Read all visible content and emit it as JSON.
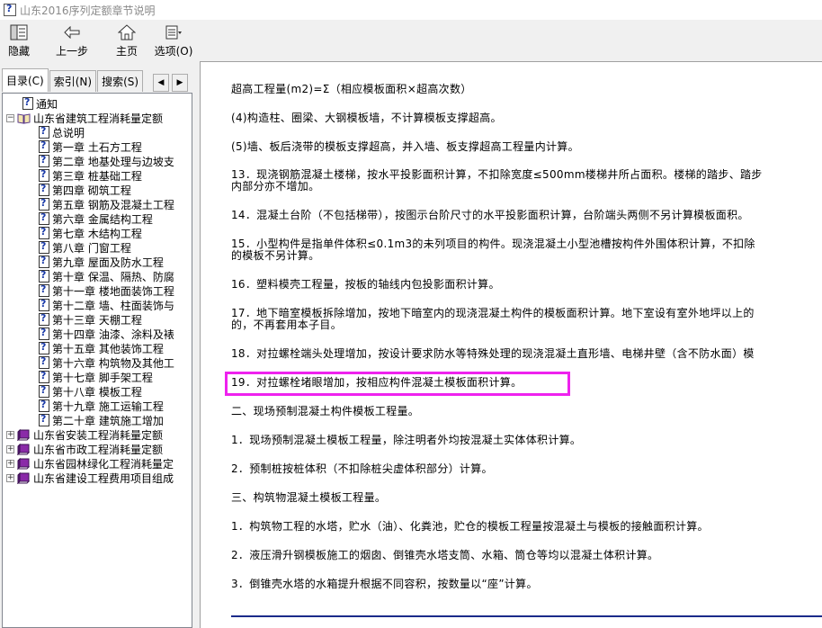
{
  "window": {
    "title": "山东2016序列定额章节说明"
  },
  "toolbar": {
    "hide": "隐藏",
    "back": "上一步",
    "home": "主页",
    "options": "选项(O)"
  },
  "tabs": [
    "目录(C)",
    "索引(N)",
    "搜索(S)"
  ],
  "tree": [
    {
      "label": "通知",
      "icon": "help-page-icon",
      "level": 1
    },
    {
      "label": "山东省建筑工程消耗量定额",
      "icon": "open-book-icon",
      "level": 0,
      "expander": "−"
    },
    {
      "label": "总说明",
      "icon": "help-page-icon",
      "level": 2
    },
    {
      "label": "第一章 土石方工程",
      "icon": "help-page-icon",
      "level": 2
    },
    {
      "label": "第二章 地基处理与边坡支",
      "icon": "help-page-icon",
      "level": 2
    },
    {
      "label": "第三章 桩基础工程",
      "icon": "help-page-icon",
      "level": 2
    },
    {
      "label": "第四章 砌筑工程",
      "icon": "help-page-icon",
      "level": 2
    },
    {
      "label": "第五章 钢筋及混凝土工程",
      "icon": "help-page-icon",
      "level": 2
    },
    {
      "label": "第六章 金属结构工程",
      "icon": "help-page-icon",
      "level": 2
    },
    {
      "label": "第七章 木结构工程",
      "icon": "help-page-icon",
      "level": 2
    },
    {
      "label": "第八章 门窗工程",
      "icon": "help-page-icon",
      "level": 2
    },
    {
      "label": "第九章 屋面及防水工程",
      "icon": "help-page-icon",
      "level": 2
    },
    {
      "label": "第十章 保温、隔热、防腐",
      "icon": "help-page-icon",
      "level": 2
    },
    {
      "label": "第十一章 楼地面装饰工程",
      "icon": "help-page-icon",
      "level": 2
    },
    {
      "label": "第十二章 墙、柱面装饰与",
      "icon": "help-page-icon",
      "level": 2
    },
    {
      "label": "第十三章 天棚工程",
      "icon": "help-page-icon",
      "level": 2
    },
    {
      "label": "第十四章 油漆、涂料及裱",
      "icon": "help-page-icon",
      "level": 2
    },
    {
      "label": "第十五章 其他装饰工程",
      "icon": "help-page-icon",
      "level": 2
    },
    {
      "label": "第十六章 构筑物及其他工",
      "icon": "help-page-icon",
      "level": 2
    },
    {
      "label": "第十七章 脚手架工程",
      "icon": "help-page-icon",
      "level": 2
    },
    {
      "label": "第十八章 模板工程",
      "icon": "help-page-icon",
      "level": 2
    },
    {
      "label": "第十九章 施工运输工程",
      "icon": "help-page-icon",
      "level": 2
    },
    {
      "label": "第二十章 建筑施工增加",
      "icon": "help-page-icon",
      "level": 2
    },
    {
      "label": "山东省安装工程消耗量定额",
      "icon": "closed-book-icon",
      "level": 0,
      "expander": "+"
    },
    {
      "label": "山东省市政工程消耗量定额",
      "icon": "closed-book-icon",
      "level": 0,
      "expander": "+"
    },
    {
      "label": "山东省园林绿化工程消耗量定",
      "icon": "closed-book-icon",
      "level": 0,
      "expander": "+"
    },
    {
      "label": "山东省建设工程费用项目组成",
      "icon": "closed-book-icon",
      "level": 0,
      "expander": "+"
    }
  ],
  "content": {
    "paragraphs": [
      {
        "text": "超高工程量(m2)=Σ（相应模板面积×超高次数）"
      },
      {
        "text": "(4)构造柱、圈梁、大钢模板墙，不计算模板支撑超高。"
      },
      {
        "text": "(5)墙、板后浇带的模板支撑超高，并入墙、板支撑超高工程量内计算。"
      },
      {
        "text": "13．现浇钢筋混凝土楼梯，按水平投影面积计算，不扣除宽度≤500mm楼梯井所占面积。楼梯的踏步、踏步",
        "text2": "内部分亦不增加。"
      },
      {
        "text": "14．混凝土台阶（不包括梯带），按图示台阶尺寸的水平投影面积计算，台阶端头两侧不另计算模板面积。"
      },
      {
        "text": "15．小型构件是指单件体积≤0.1m3的未列项目的构件。现浇混凝土小型池槽按构件外围体积计算，不扣除",
        "text2": "的模板不另计算。"
      },
      {
        "text": "16．塑料模壳工程量，按板的轴线内包投影面积计算。"
      },
      {
        "text": "17．地下暗室模板拆除增加，按地下暗室内的现浇混凝土构件的模板面积计算。地下室设有室外地坪以上的",
        "text2": "的，不再套用本子目。"
      },
      {
        "text": "18．对拉螺栓端头处理增加，按设计要求防水等特殊处理的现浇混凝土直形墙、电梯井壁（含不防水面）模"
      },
      {
        "text": "19．对拉螺栓堵眼增加，按相应构件混凝土模板面积计算。"
      },
      {
        "text": "二、现场预制混凝土构件模板工程量。"
      },
      {
        "text": "1．现场预制混凝土模板工程量，除注明者外均按混凝土实体体积计算。"
      },
      {
        "text": "2．预制桩按桩体积（不扣除桩尖虚体积部分）计算。"
      },
      {
        "text": "三、构筑物混凝土模板工程量。"
      },
      {
        "text": "1．构筑物工程的水塔，贮水（油）、化粪池，贮仓的模板工程量按混凝土与模板的接触面积计算。"
      },
      {
        "text": "2．液压滑升钢模板施工的烟囱、倒锥壳水塔支筒、水箱、筒仓等均以混凝土体积计算。"
      },
      {
        "text": "3．倒锥壳水塔的水箱提升根据不同容积，按数量以“座”计算。"
      }
    ]
  },
  "colors": {
    "highlight": "#ee22ee",
    "rule": "#1b2a8a"
  }
}
